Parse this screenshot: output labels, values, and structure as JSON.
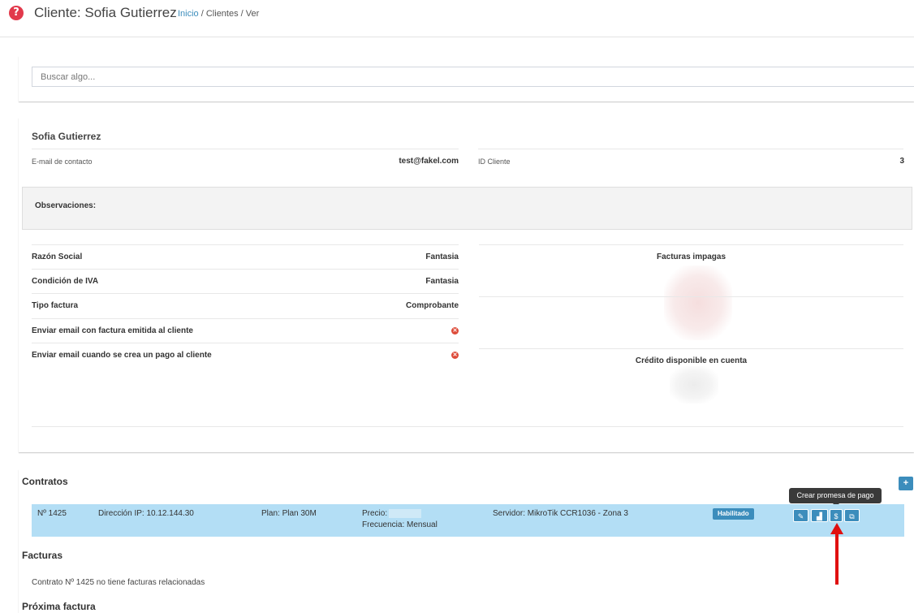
{
  "header": {
    "title": "Cliente: Sofia Gutierrez",
    "breadcrumb": {
      "home": "Inicio",
      "rest": " / Clientes / Ver"
    },
    "help_icon": "help-circle-icon",
    "accent": "#e2394b"
  },
  "search": {
    "placeholder": "Buscar algo..."
  },
  "client": {
    "name": "Sofia Gutierrez",
    "email_label": "E-mail de contacto",
    "email_value": "test@fakel.com",
    "id_label": "ID Cliente",
    "id_value": "3",
    "observations_label": "Observaciones:",
    "details": [
      {
        "label": "Razón Social",
        "value": "Fantasia"
      },
      {
        "label": "Condición de IVA",
        "value": "Fantasia"
      },
      {
        "label": "Tipo factura",
        "value": "Comprobante"
      },
      {
        "label": "Enviar email con factura emitida al cliente",
        "value": "",
        "icon": "x-circle-icon"
      },
      {
        "label": "Enviar email cuando se crea un pago al cliente",
        "value": "",
        "icon": "x-circle-icon"
      }
    ],
    "unpaid_title": "Facturas impagas",
    "credit_title": "Crédito disponible en cuenta"
  },
  "contracts": {
    "title": "Contratos",
    "add_label": "+",
    "row": {
      "number": "Nº 1425",
      "ip": "Dirección IP: 10.12.144.30",
      "plan": "Plan: Plan 30M",
      "price_label": "Precio:",
      "frequency": "Frecuencia: Mensual",
      "server": "Servidor: MikroTik CCR1036 - Zona 3",
      "status": "Habilitado",
      "actions": [
        {
          "icon": "pencil-icon",
          "glyph": "✎"
        },
        {
          "icon": "chart-icon",
          "glyph": "▟"
        },
        {
          "icon": "dollar-icon",
          "glyph": "$"
        },
        {
          "icon": "copy-icon",
          "glyph": "⧉"
        }
      ],
      "tooltip": "Crear promesa de pago",
      "row_color": "#b3def5",
      "status_color": "#3c8dbc"
    },
    "invoices_title": "Facturas",
    "invoices_empty": "Contrato Nº 1425 no tiene facturas relacionadas",
    "next_invoice_title": "Próxima factura"
  }
}
